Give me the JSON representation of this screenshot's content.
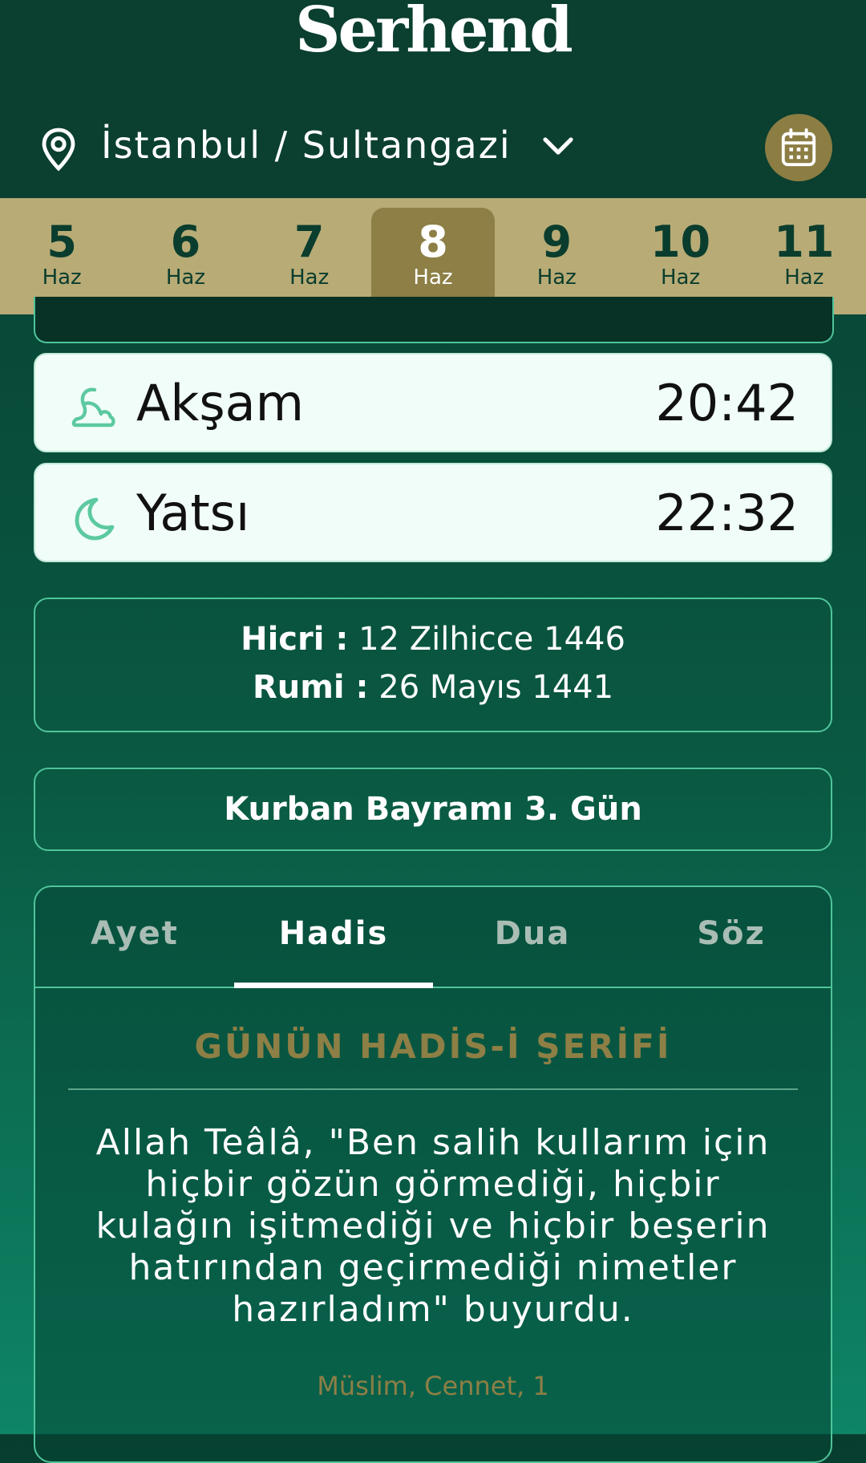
{
  "app": {
    "logo": "Serhend"
  },
  "location": {
    "label": "İstanbul / Sultangazi"
  },
  "icons": {
    "location": "map-pin-icon",
    "dropdown": "chevron-down-icon",
    "calendar": "calendar-icon",
    "aksam": "sunset-icon",
    "yatsi": "moon-icon"
  },
  "days": [
    {
      "num": "5",
      "month": "Haz"
    },
    {
      "num": "6",
      "month": "Haz"
    },
    {
      "num": "7",
      "month": "Haz"
    },
    {
      "num": "8",
      "month": "Haz",
      "selected": true
    },
    {
      "num": "9",
      "month": "Haz"
    },
    {
      "num": "10",
      "month": "Haz"
    },
    {
      "num": "11",
      "month": "Haz"
    }
  ],
  "prayers": [
    {
      "name": "Akşam",
      "time": "20:42"
    },
    {
      "name": "Yatsı",
      "time": "22:32"
    }
  ],
  "calendar_info": {
    "hicri_label": "Hicri :",
    "hicri_value": "12 Zilhicce 1446",
    "rumi_label": "Rumi :",
    "rumi_value": "26 Mayıs 1441"
  },
  "event": "Kurban Bayramı 3. Gün",
  "tabs": [
    {
      "label": "Ayet"
    },
    {
      "label": "Hadis",
      "selected": true
    },
    {
      "label": "Dua"
    },
    {
      "label": "Söz"
    }
  ],
  "content": {
    "title": "GÜNÜN HADİS-İ ŞERİFİ",
    "text": "Allah Teâlâ, \"Ben salih kullarım için hiçbir gözün görmediği, hiçbir kulağın işitmediği ve hiçbir beşerin hatırından geçirmediği nimetler hazırladım\" buyurdu.",
    "source": "Müslim, Cennet, 1"
  },
  "colors": {
    "header_bg": "#0b3f30",
    "strip_bg": "#b8ab76",
    "accent_gold": "#8d7f45",
    "border_green": "#4fc49a",
    "card_bg": "#f1fdf8"
  }
}
